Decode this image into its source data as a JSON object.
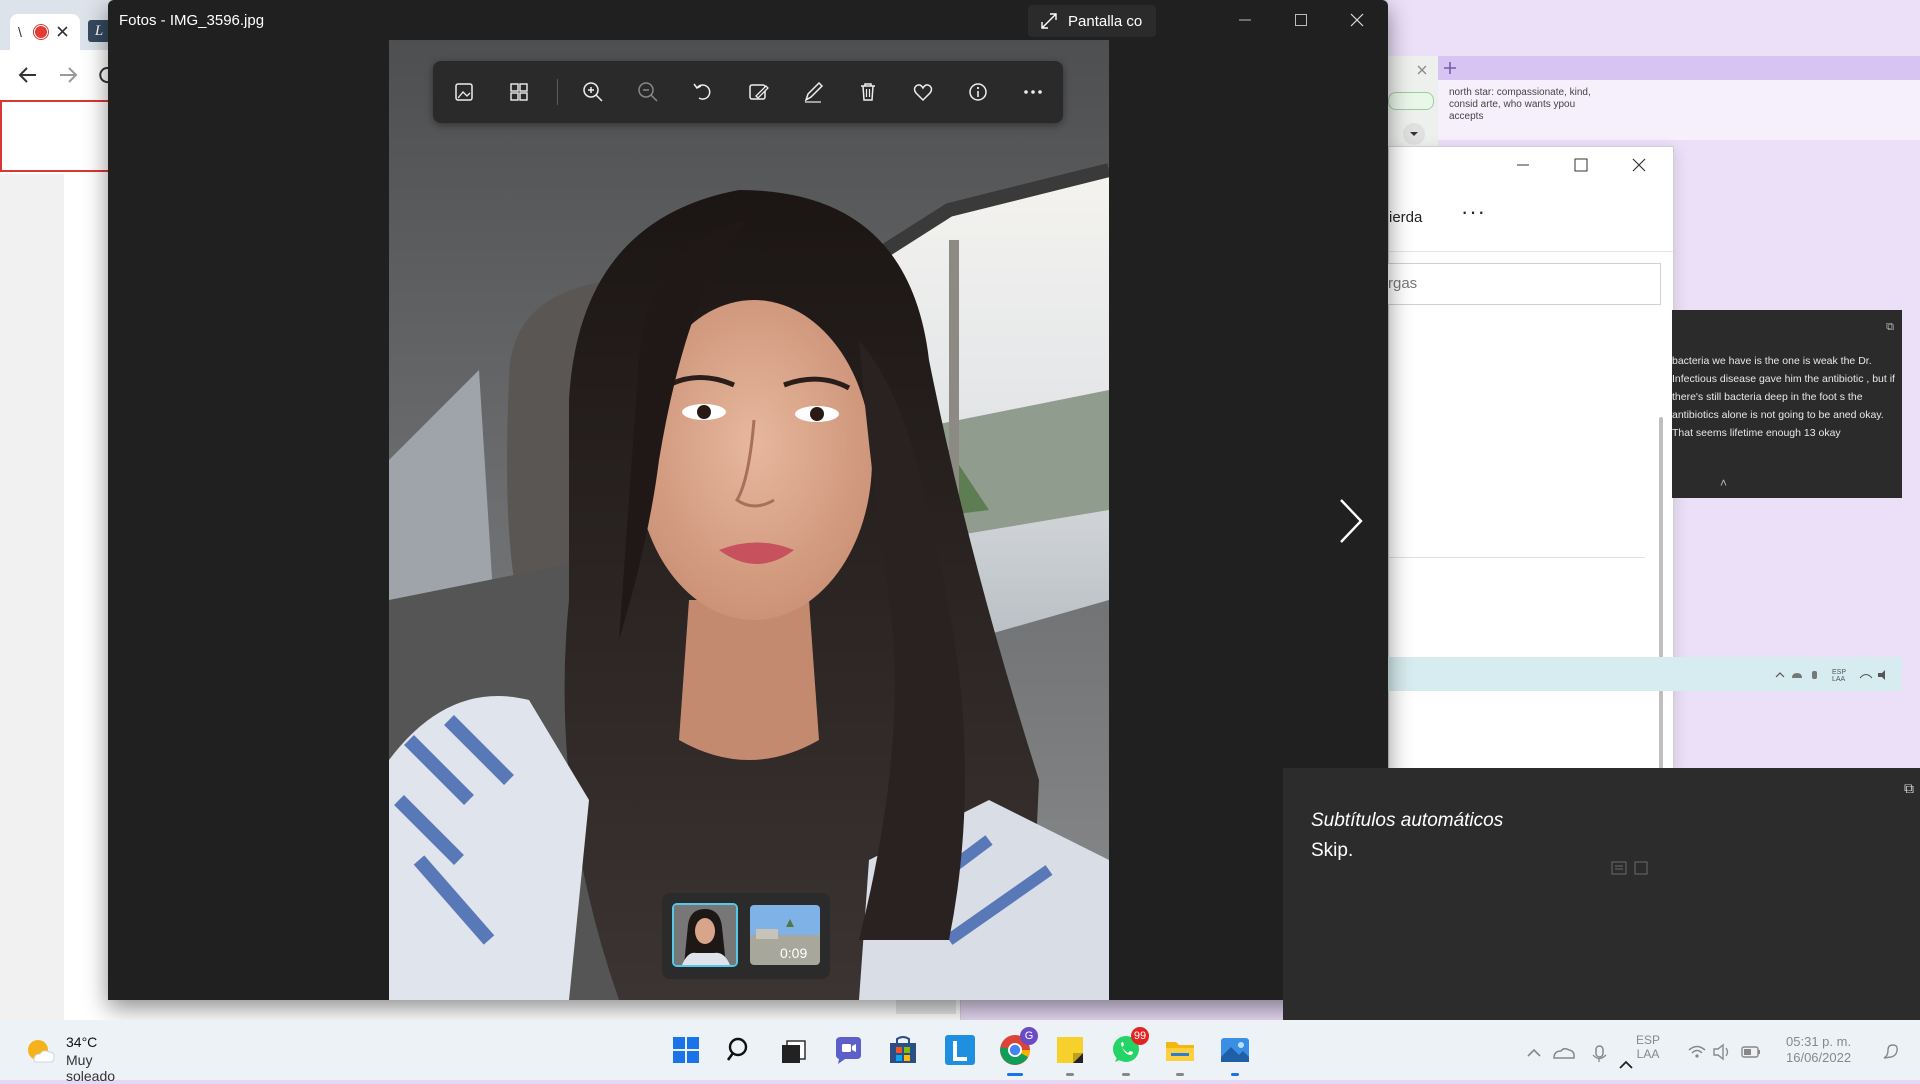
{
  "photos_window": {
    "title": "Fotos - IMG_3596.jpg",
    "fullscreen_label": "Pantalla co",
    "toolbar": [
      "photo-icon",
      "gallery-icon",
      "zoom-in-icon",
      "zoom-out-icon",
      "rotate-icon",
      "edit-image-icon",
      "draw-icon",
      "delete-icon",
      "heart-icon",
      "info-icon",
      "more-icon"
    ],
    "filmstrip": {
      "video_duration": "0:09"
    }
  },
  "captions": {
    "title": "Subtítulos automáticos",
    "text": "Skip."
  },
  "background_notes": {
    "text": "north star: compassionate, kind, consid arte, who wants ypou accepts"
  },
  "background_settings": {
    "menu_label": "ierda",
    "search_placeholder": "rgas"
  },
  "transcript": {
    "text": "bacteria we have is the one is weak the Dr. Infectious disease gave him the antibiotic , but if there's still bacteria deep in the foot s the antibiotics alone is not going to be aned okay. That seems lifetime enough 13 okay"
  },
  "taskbar": {
    "weather_temp": "34°C",
    "weather_desc": "Muy soleado",
    "whatsapp_badge": "99",
    "chrome_badge": "G",
    "language": "ESP",
    "language_sub": "LAA",
    "time": "05:31 p. m.",
    "date": "16/06/2022"
  },
  "colors": {
    "photos_bg": "#202020",
    "accent_cyan": "#58c8e8",
    "taskbar_bg": "#edf2f7",
    "captions_bg": "#2c2c2c"
  }
}
